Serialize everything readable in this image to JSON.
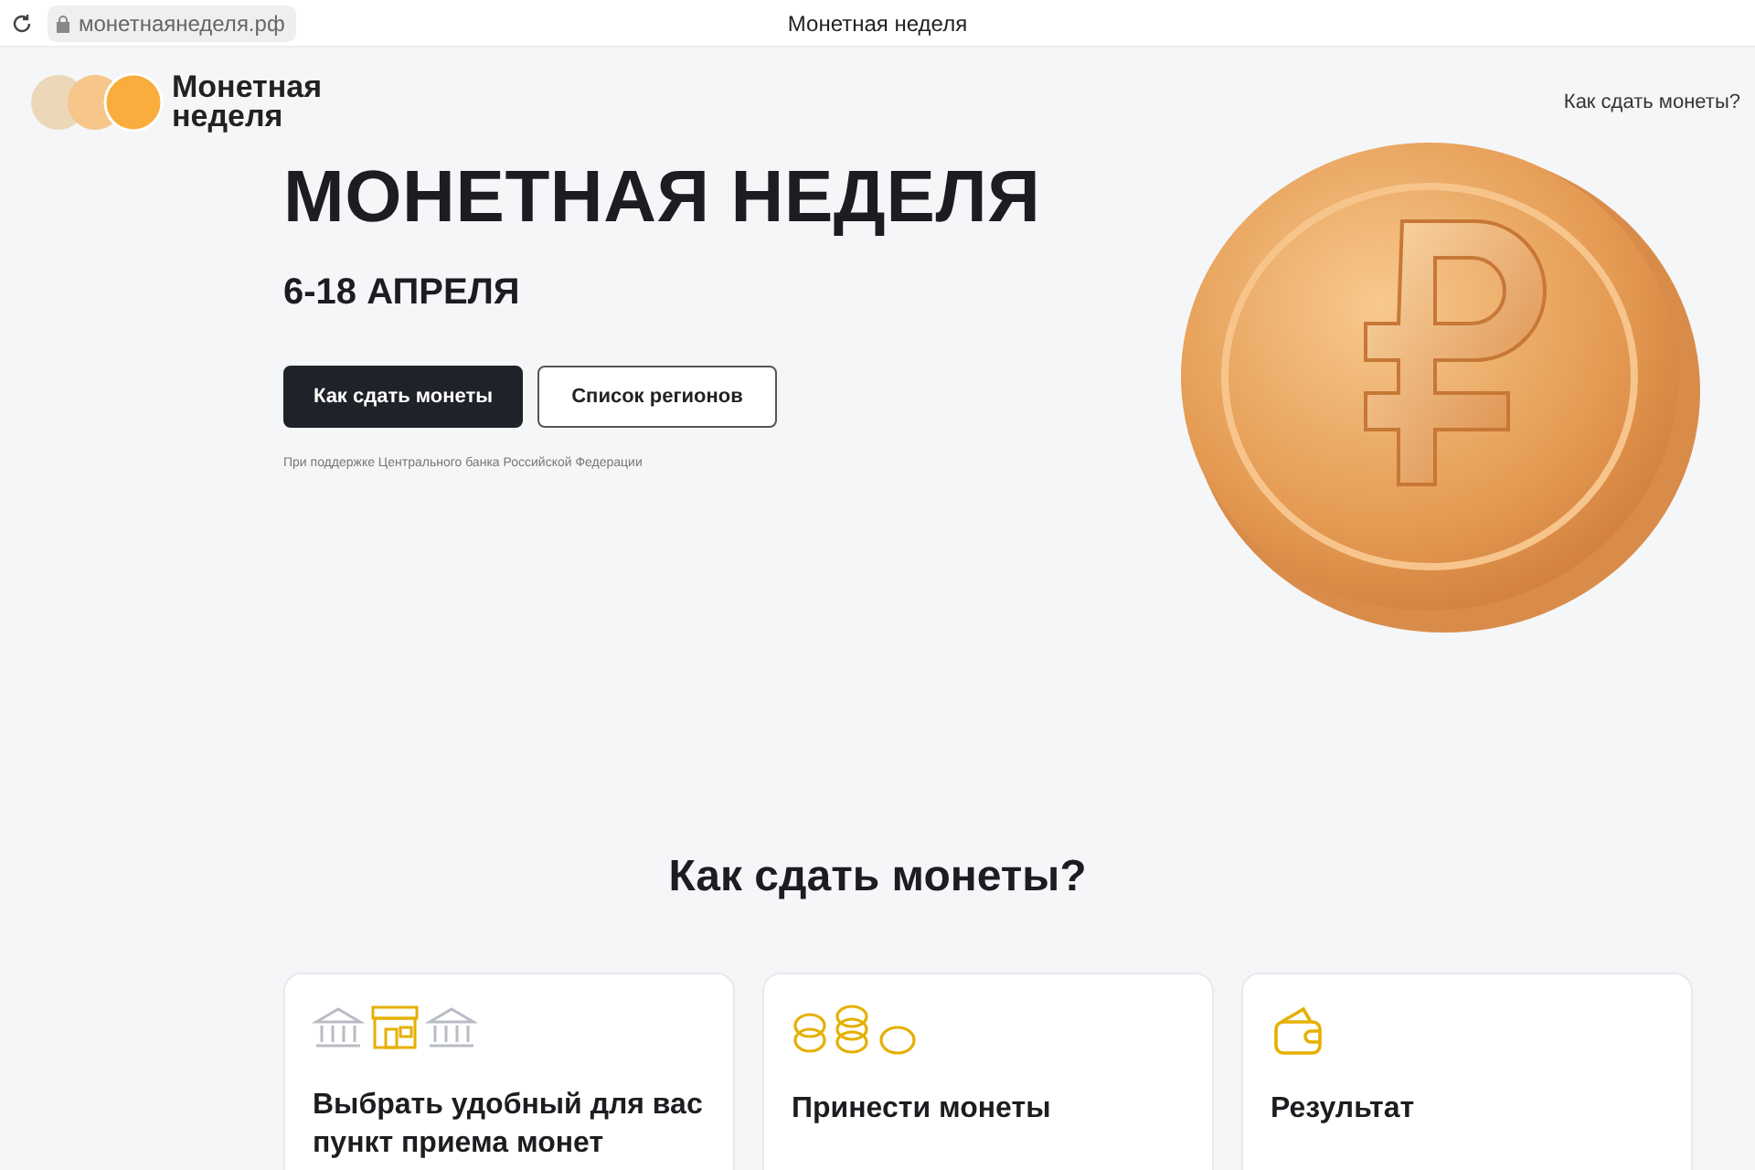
{
  "browser": {
    "url": "монетнаянеделя.рф",
    "title": "Монетная неделя"
  },
  "header": {
    "logo": [
      "Монетная",
      "неделя"
    ],
    "nav_link": "Как сдать монеты?"
  },
  "hero": {
    "title": "МОНЕТНАЯ НЕДЕЛЯ",
    "dates": "6-18 АПРЕЛЯ",
    "buttons": [
      {
        "label": "Как сдать монеты",
        "kind": "primary"
      },
      {
        "label": "Список регионов",
        "kind": "outline"
      }
    ],
    "note": "При поддержке Центрального банка Российской Федерации"
  },
  "section": {
    "title": "Как сдать монеты?",
    "cards": [
      {
        "kind": "banks",
        "title": "Выбрать удобный для вас пункт приема монет"
      },
      {
        "kind": "coins",
        "title": "Принести монеты"
      },
      {
        "kind": "wallet",
        "title": "Результат"
      }
    ]
  }
}
